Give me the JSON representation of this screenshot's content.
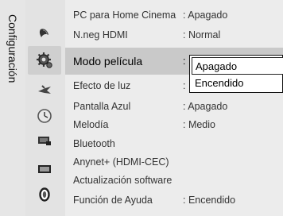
{
  "section": {
    "title": "Configuración"
  },
  "menu": {
    "items": [
      {
        "label": "PC para Home Cinema",
        "value": ": Apagado"
      },
      {
        "label": "N.neg HDMI",
        "value": ": Normal"
      },
      {
        "label": "Modo película",
        "value": ":"
      },
      {
        "label": "Efecto de luz",
        "value": ":"
      },
      {
        "label": "Pantalla Azul",
        "value": ": Apagado"
      },
      {
        "label": "Melodía",
        "value": ": Medio"
      },
      {
        "label": "Bluetooth",
        "value": ""
      },
      {
        "label": "Anynet+ (HDMI-CEC)",
        "value": ""
      },
      {
        "label": "Actualización software",
        "value": ""
      },
      {
        "label": "Función de Ayuda",
        "value": ": Encendido"
      }
    ],
    "selected_index": 2
  },
  "dropdown": {
    "options": [
      "Apagado",
      "Encendido"
    ],
    "highlighted_index": 0
  },
  "icons": [
    "picture-icon",
    "sound-icon",
    "setup-icon",
    "input-icon",
    "timer-icon",
    "channel-icon",
    "media-icon",
    "support-icon"
  ],
  "colors": {
    "panel": "#ececec",
    "selected": "#c9c9c9",
    "band": "#e3e3e3"
  }
}
